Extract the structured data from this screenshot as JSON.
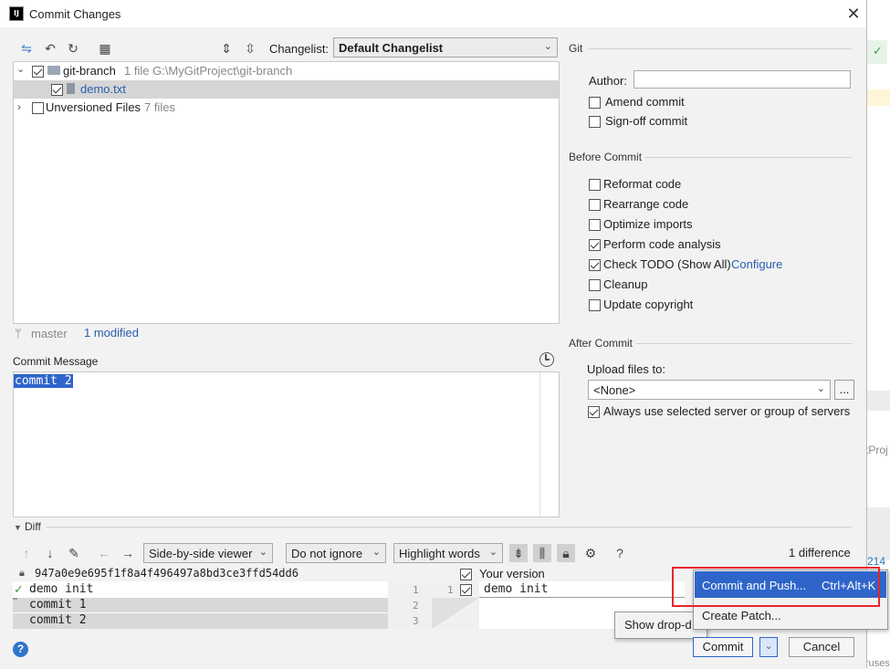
{
  "window": {
    "title": "Commit Changes",
    "logo_text": "IJ",
    "close_icon": "close-icon"
  },
  "toolbar": {
    "changelist_label": "Changelist:",
    "changelist_value": "Default Changelist"
  },
  "tree": {
    "root": {
      "name": "git-branch",
      "meta": "1 file  G:\\MyGitProject\\git-branch"
    },
    "file": {
      "name": "demo.txt"
    },
    "unversioned": {
      "name": "Unversioned Files",
      "meta": "7 files"
    }
  },
  "status": {
    "branch": "master",
    "modified": "1 modified"
  },
  "commit_message": {
    "label": "Commit Message",
    "text": "commit 2"
  },
  "git": {
    "title": "Git",
    "author_label": "Author:",
    "author_value": "",
    "amend": "Amend commit",
    "signoff": "Sign-off commit"
  },
  "before_commit": {
    "title": "Before Commit",
    "options": [
      {
        "label": "Reformat code",
        "checked": false
      },
      {
        "label": "Rearrange code",
        "checked": false
      },
      {
        "label": "Optimize imports",
        "checked": false
      },
      {
        "label": "Perform code analysis",
        "checked": true
      },
      {
        "label": "Check TODO (Show All)",
        "checked": true
      },
      {
        "label": "Cleanup",
        "checked": false
      },
      {
        "label": "Update copyright",
        "checked": false
      }
    ],
    "configure_link": "Configure"
  },
  "after_commit": {
    "title": "After Commit",
    "upload_label": "Upload files to:",
    "upload_value": "<None>",
    "more_button": "...",
    "always_use": "Always use selected server or group of servers"
  },
  "diff": {
    "title": "Diff",
    "viewer": "Side-by-side viewer",
    "ignore": "Do not ignore",
    "highlight": "Highlight words",
    "count": "1 difference",
    "left_hash": "947a0e9e695f1f8a4f496497a8bd3ce3ffd54dd6",
    "right_title": "Your version",
    "left_lines": [
      "demo init",
      "commit 1",
      "commit 2"
    ],
    "left_nums": [
      "1",
      "2",
      "3"
    ],
    "right_nums": [
      "1"
    ],
    "right_lines": [
      "demo init"
    ]
  },
  "popup": {
    "commit_and_push": "Commit and Push...",
    "shortcut": "Ctrl+Alt+K",
    "create_patch": "Create Patch..."
  },
  "tooltip": {
    "text": "Show drop-d"
  },
  "buttons": {
    "commit": "Commit",
    "cancel": "Cancel",
    "help": "?"
  },
  "ide_bg": {
    "text1": "tProj",
    "text2": "214",
    "text3": "ruses"
  },
  "colors": {
    "accent": "#2f65ca",
    "highlight_border": "#e8262a",
    "selection": "#2f65ca"
  }
}
